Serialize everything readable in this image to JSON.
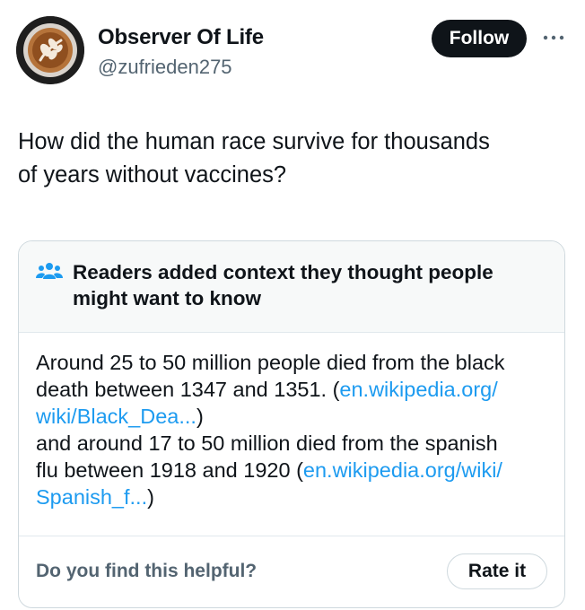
{
  "author": {
    "name": "Observer Of Life",
    "handle": "@zufrieden275",
    "avatar_icon": "latte-art-avatar"
  },
  "actions": {
    "follow_label": "Follow",
    "more_icon": "more-horizontal-icon"
  },
  "tweet": {
    "line1": "How did the human race survive for thousands",
    "line2": "of years without vaccines?"
  },
  "community_note": {
    "icon": "people-icon",
    "title_line1": "Readers added context they thought people",
    "title_line2": "might want to know",
    "body": {
      "l1": "Around 25 to 50 million people died from the black",
      "l2_text": "death between 1347 and 1351. (",
      "l2_link": "en.wikipedia.org/",
      "l3_link": "wiki/Black_Dea...",
      "l3_text": ")",
      "l4": "and around 17  to 50 million died from the spanish",
      "l5_text": "flu between 1918 and 1920 (",
      "l5_link": "en.wikipedia.org/wiki/",
      "l6_link": "Spanish_f...",
      "l6_text": ")"
    },
    "helpful_question": "Do you find this helpful?",
    "rate_label": "Rate it"
  },
  "colors": {
    "text": "#0f1419",
    "secondary": "#536471",
    "link": "#1d9bf0",
    "follow_bg": "#0f1419",
    "note_header_bg": "#f7f9f9",
    "border": "#cfd9de"
  }
}
